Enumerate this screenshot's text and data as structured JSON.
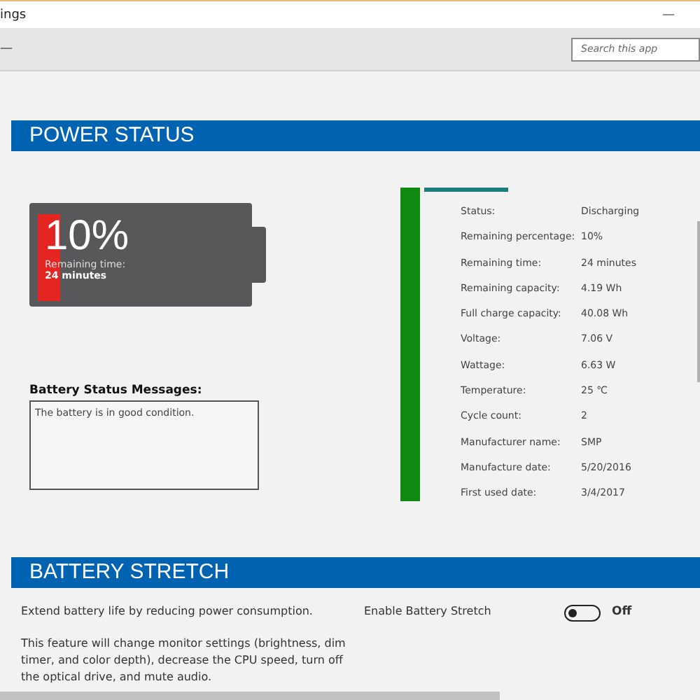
{
  "window": {
    "title": "ings",
    "minimize": "—"
  },
  "toolbar": {
    "menu": "—",
    "search": {
      "placeholder": "Search this app"
    }
  },
  "power_status": {
    "heading": "POWER STATUS",
    "battery": {
      "percentage": "10%",
      "level": 0.1,
      "time_label": "Remaining time:",
      "time_value": "24 minutes"
    },
    "messages": {
      "label": "Battery Status Messages:",
      "text": "The battery is in good condition."
    },
    "details": [
      {
        "label": "Status:",
        "value": "Discharging"
      },
      {
        "label": "Remaining percentage:",
        "value": "10%"
      },
      {
        "label": "Remaining time:",
        "value": "24 minutes"
      },
      {
        "label": "Remaining capacity:",
        "value": "4.19 Wh"
      },
      {
        "label": "Full charge capacity:",
        "value": "40.08 Wh"
      },
      {
        "label": "Voltage:",
        "value": "7.06 V"
      },
      {
        "label": "Wattage:",
        "value": "6.63 W"
      },
      {
        "label": "Temperature:",
        "value": "25 ℃"
      },
      {
        "label": "Cycle count:",
        "value": "2"
      },
      {
        "label": "Manufacturer name:",
        "value": "SMP"
      },
      {
        "label": "Manufacture date:",
        "value": "5/20/2016"
      },
      {
        "label": "First used date:",
        "value": "3/4/2017"
      }
    ]
  },
  "battery_stretch": {
    "heading": "BATTERY STRETCH",
    "summary": "Extend battery life by reducing power consumption.",
    "description": "This feature will change monitor settings (brightness, dim timer, and color depth), decrease the CPU speed, turn off the optical drive, and mute audio.",
    "toggle": {
      "label": "Enable Battery Stretch",
      "on": false,
      "state_text": "Off"
    }
  }
}
